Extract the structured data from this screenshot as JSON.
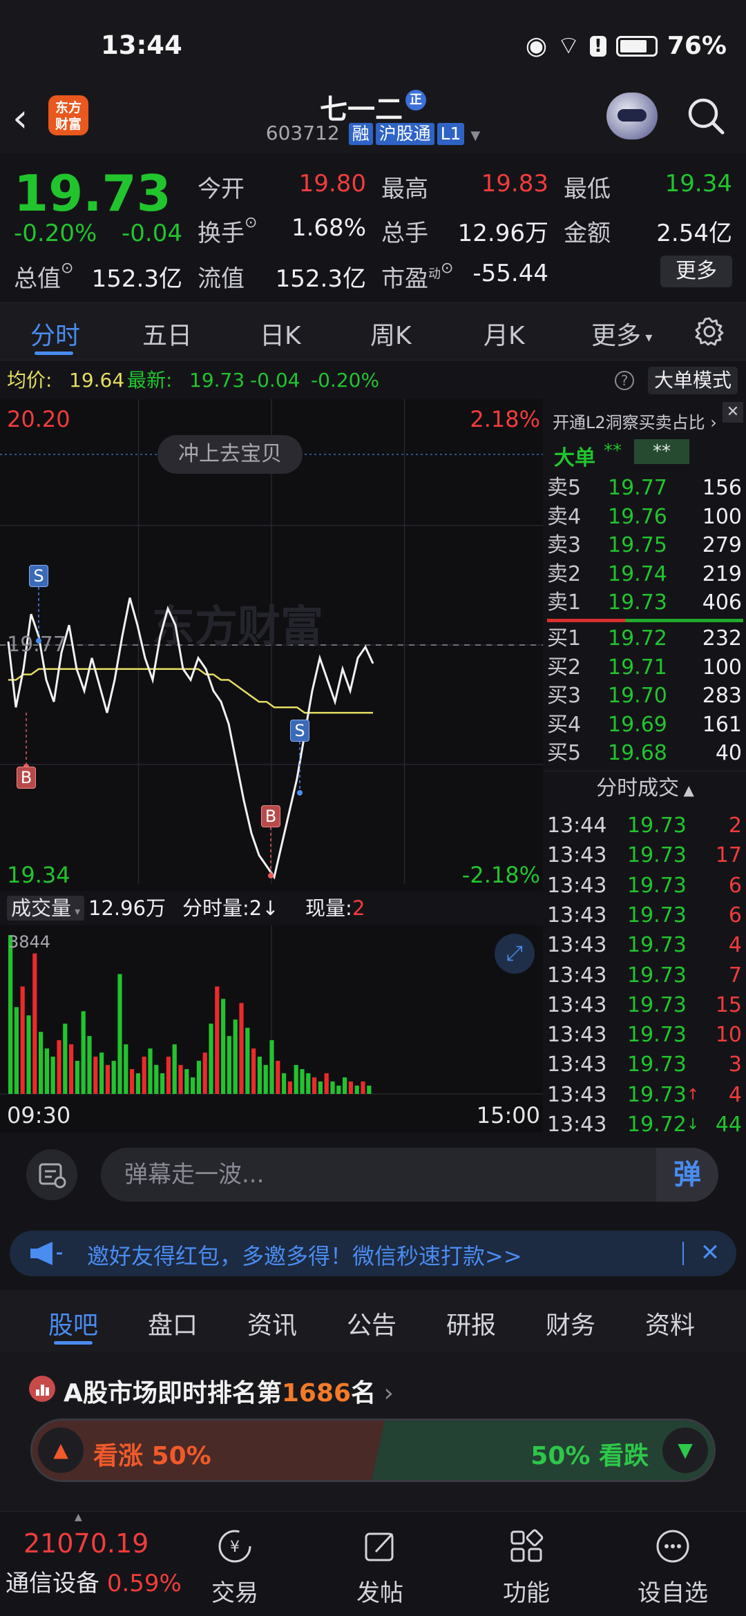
{
  "status": {
    "time": "13:44",
    "battery": "76%"
  },
  "header": {
    "logo_line1": "东方",
    "logo_line2": "财富",
    "name": "七一二",
    "name_badge": "正",
    "code": "603712",
    "tags": [
      "融",
      "沪股通",
      "L1"
    ]
  },
  "quote": {
    "price": "19.73",
    "change_pct": "-0.20%",
    "change": "-0.04",
    "open_label": "今开",
    "open": "19.80",
    "high_label": "最高",
    "high": "19.83",
    "low_label": "最低",
    "low": "19.34",
    "turnover_label": "换手",
    "turnover": "1.68%",
    "volume_label": "总手",
    "volume": "12.96万",
    "amount_label": "金额",
    "amount": "2.54亿",
    "mktcap_label": "总值",
    "mktcap": "152.3亿",
    "float_label": "流值",
    "float": "152.3亿",
    "pe_label": "市盈",
    "pe_sup": "动",
    "pe": "-55.44",
    "more": "更多"
  },
  "tabs": [
    "分时",
    "五日",
    "日K",
    "周K",
    "月K",
    "更多"
  ],
  "avgline": {
    "avg_label": "均价:",
    "avg": "19.64",
    "last_label": "最新:",
    "last": "19.73",
    "chg": "-0.04",
    "pct": "-0.20%",
    "big_mode": "大单模式",
    "help": "?"
  },
  "chart": {
    "y_high": "20.20",
    "y_low": "19.34",
    "pct_high": "2.18%",
    "pct_low": "-2.18%",
    "ref": "19.77",
    "watermark": "东方财富",
    "bubble": "冲上去宝贝",
    "markers": [
      "S",
      "B",
      "S",
      "B"
    ],
    "vol_label": "成交量",
    "vol_total": "12.96万",
    "vol_fen": "分时量:2↓",
    "vol_now_label": "现量:",
    "vol_now": "2",
    "vol_max": "3844",
    "time_start": "09:30",
    "time_end": "15:00"
  },
  "chart_data": {
    "type": "line",
    "title": "",
    "ylim": [
      19.34,
      20.2
    ],
    "xlim": [
      "09:30",
      "15:00"
    ],
    "series": [
      {
        "values": [
          19.77,
          19.65,
          19.72,
          19.82,
          19.78,
          19.7,
          19.66,
          19.75,
          19.8,
          19.72,
          19.68,
          19.74,
          19.69,
          19.64,
          19.7,
          19.78,
          19.85,
          19.8,
          19.74,
          19.7,
          19.78,
          19.83,
          19.8,
          19.72,
          19.7,
          19.74,
          19.72,
          19.68,
          19.66,
          19.62,
          19.55,
          19.48,
          19.42,
          19.38,
          19.36,
          19.34,
          19.4,
          19.46,
          19.52,
          19.6,
          19.68,
          19.74,
          19.7,
          19.66,
          19.72,
          19.68,
          19.74,
          19.76,
          19.73
        ]
      },
      {
        "values": [
          19.7,
          19.7,
          19.71,
          19.71,
          19.72,
          19.72,
          19.72,
          19.72,
          19.72,
          19.72,
          19.72,
          19.72,
          19.72,
          19.72,
          19.72,
          19.72,
          19.72,
          19.72,
          19.72,
          19.72,
          19.72,
          19.72,
          19.72,
          19.72,
          19.72,
          19.72,
          19.71,
          19.71,
          19.7,
          19.7,
          19.69,
          19.68,
          19.67,
          19.66,
          19.66,
          19.65,
          19.65,
          19.65,
          19.65,
          19.64,
          19.64,
          19.64,
          19.64,
          19.64,
          19.64,
          19.64,
          19.64,
          19.64,
          19.64
        ]
      }
    ],
    "volume": [
      3844,
      2100,
      2600,
      1900,
      3400,
      1500,
      1100,
      900,
      1300,
      1700,
      1200,
      800,
      2000,
      1400,
      900,
      1000,
      700,
      800,
      2900,
      1200,
      600,
      500,
      900,
      1100,
      700,
      500,
      900,
      1200,
      700,
      600,
      400,
      800,
      1000,
      1700,
      2600,
      2300,
      1400,
      1800,
      2200,
      1600,
      1100,
      900,
      700,
      1300,
      800,
      500,
      300,
      700,
      600,
      500,
      400,
      300,
      500,
      300,
      200,
      400,
      300,
      200,
      300,
      200
    ]
  },
  "l2": {
    "title": "开通L2洞察买卖占比",
    "big_label": "大单",
    "big_v1": "**",
    "big_v2": "**"
  },
  "orderbook": {
    "sells": [
      {
        "label": "卖5",
        "price": "19.77",
        "vol": "156"
      },
      {
        "label": "卖4",
        "price": "19.76",
        "vol": "100"
      },
      {
        "label": "卖3",
        "price": "19.75",
        "vol": "279"
      },
      {
        "label": "卖2",
        "price": "19.74",
        "vol": "219"
      },
      {
        "label": "卖1",
        "price": "19.73",
        "vol": "406"
      }
    ],
    "buys": [
      {
        "label": "买1",
        "price": "19.72",
        "vol": "232"
      },
      {
        "label": "买2",
        "price": "19.71",
        "vol": "100"
      },
      {
        "label": "买3",
        "price": "19.70",
        "vol": "283"
      },
      {
        "label": "买4",
        "price": "19.69",
        "vol": "161"
      },
      {
        "label": "买5",
        "price": "19.68",
        "vol": "40"
      }
    ]
  },
  "trades": {
    "title": "分时成交",
    "rows": [
      {
        "time": "13:44",
        "price": "19.73",
        "vol": "2",
        "dir": ""
      },
      {
        "time": "13:43",
        "price": "19.73",
        "vol": "17",
        "dir": ""
      },
      {
        "time": "13:43",
        "price": "19.73",
        "vol": "6",
        "dir": ""
      },
      {
        "time": "13:43",
        "price": "19.73",
        "vol": "6",
        "dir": ""
      },
      {
        "time": "13:43",
        "price": "19.73",
        "vol": "4",
        "dir": ""
      },
      {
        "time": "13:43",
        "price": "19.73",
        "vol": "7",
        "dir": ""
      },
      {
        "time": "13:43",
        "price": "19.73",
        "vol": "15",
        "dir": ""
      },
      {
        "time": "13:43",
        "price": "19.73",
        "vol": "10",
        "dir": ""
      },
      {
        "time": "13:43",
        "price": "19.73",
        "vol": "3",
        "dir": ""
      },
      {
        "time": "13:43",
        "price": "19.73",
        "vol": "4",
        "dir": "↑"
      },
      {
        "time": "13:43",
        "price": "19.72",
        "vol": "44",
        "dir": "↓"
      }
    ]
  },
  "danmu": {
    "placeholder": "弹幕走一波...",
    "button": "弹"
  },
  "banner": {
    "text": "邀好友得红包，多邀多得！微信秒速打款>>"
  },
  "bottom_tabs": [
    "股吧",
    "盘口",
    "资讯",
    "公告",
    "研报",
    "财务",
    "资料"
  ],
  "rank": {
    "prefix": "A股市场即时排名第",
    "number": "1686",
    "suffix": "名"
  },
  "vote": {
    "up": "看涨 50%",
    "down": "50% 看跌"
  },
  "footer": {
    "index_value": "21070.19",
    "index_name": "通信设备",
    "index_pct": "0.59%",
    "items": [
      "交易",
      "发帖",
      "功能",
      "设自选"
    ]
  },
  "colors": {
    "up": "#f23c3c",
    "down": "#22c42e",
    "accent": "#4a8cf0",
    "avg_line": "#e6de62"
  }
}
